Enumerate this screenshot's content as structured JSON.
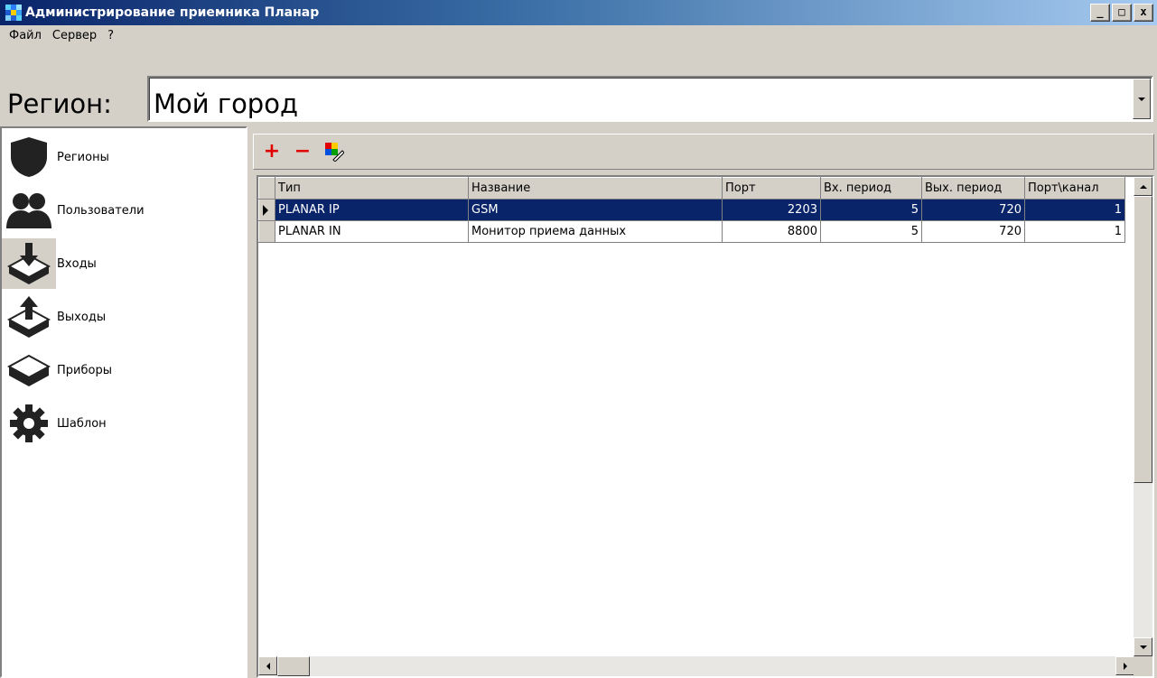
{
  "window": {
    "title": "Администрирование приемника Планар",
    "controls": {
      "minimize": "_",
      "maximize": "□",
      "close": "x"
    }
  },
  "menu": {
    "items": [
      "Файл",
      "Сервер",
      "?"
    ]
  },
  "region": {
    "label": "Регион:",
    "value": "Мой город"
  },
  "sidebar": {
    "items": [
      {
        "label": "Регионы",
        "icon": "shield-icon"
      },
      {
        "label": "Пользователи",
        "icon": "users-icon"
      },
      {
        "label": "Входы",
        "icon": "inputs-icon",
        "active": true
      },
      {
        "label": "Выходы",
        "icon": "outputs-icon"
      },
      {
        "label": "Приборы",
        "icon": "devices-icon"
      },
      {
        "label": "Шаблон",
        "icon": "gear-icon"
      }
    ]
  },
  "toolbar": {
    "add": "+",
    "remove": "−"
  },
  "table": {
    "columns": [
      "Тип",
      "Название",
      "Порт",
      "Вх. период",
      "Вых. период",
      "Порт\\канал"
    ],
    "rows": [
      {
        "type": "PLANAR IP",
        "name": "GSM",
        "port": "2203",
        "in_period": "5",
        "out_period": "720",
        "channel": "1",
        "selected": true
      },
      {
        "type": "PLANAR IN",
        "name": "Монитор приема данных",
        "port": "8800",
        "in_period": "5",
        "out_period": "720",
        "channel": "1",
        "selected": false
      }
    ]
  },
  "colors": {
    "selection": "#0a246a",
    "title_start": "#0a246a",
    "title_end": "#a6caf0",
    "accent_red": "#e00000"
  }
}
